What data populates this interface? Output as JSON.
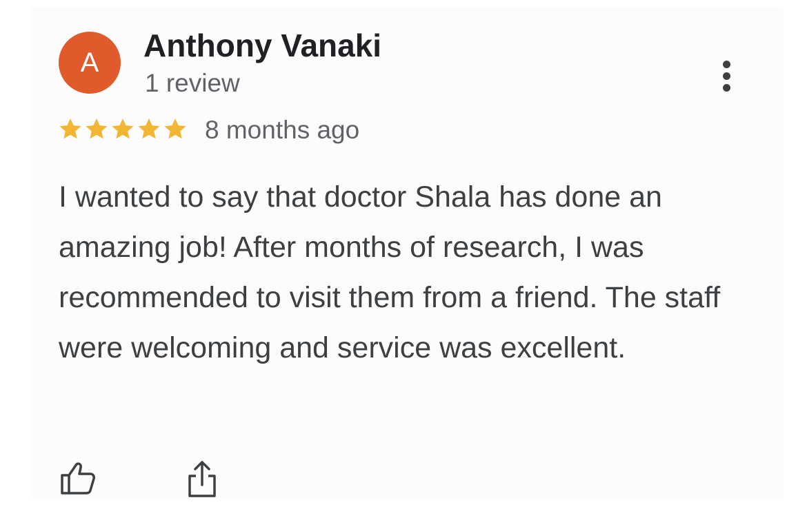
{
  "review": {
    "avatar_initial": "A",
    "avatar_color": "#e05a2b",
    "reviewer_name": "Anthony Vanaki",
    "review_count": "1 review",
    "rating": 5,
    "rating_max": 5,
    "star_color": "#f2b632",
    "time_ago": "8 months ago",
    "text": "I wanted to say that doctor Shala has done an amazing job! After months of research, I was recommended to visit them from a friend. The staff were welcoming and service was excellent."
  },
  "icons": {
    "more": "more-vert-icon",
    "like": "thumb-up-icon",
    "share": "share-icon"
  }
}
